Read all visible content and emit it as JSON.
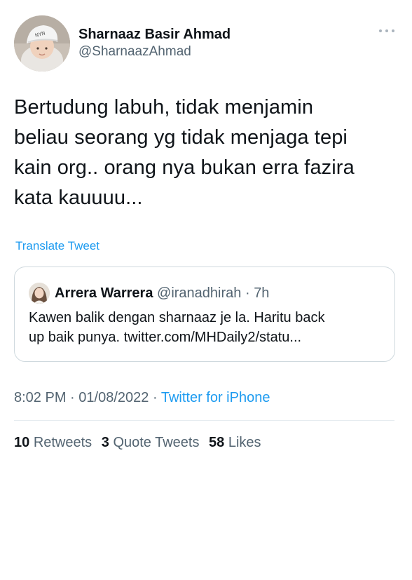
{
  "author": {
    "display_name": "Sharnaaz Basir Ahmad",
    "handle": "@SharnaazAhmad"
  },
  "tweet": {
    "lines": [
      "Bertudung labuh, tidak menjamin",
      "beliau seorang yg tidak menjaga tepi",
      "kain org.. orang nya bukan erra fazira",
      "kata kauuuu..."
    ],
    "translate_label": "Translate Tweet"
  },
  "quote": {
    "display_name": "Arrera Warrera",
    "handle": "@iranadhirah",
    "separator": "·",
    "time": "7h",
    "lines": [
      "Kawen balik dengan sharnaaz je la. Haritu back",
      "up baik punya. twitter.com/MHDaily2/statu..."
    ]
  },
  "meta": {
    "time": "8:02 PM",
    "separator": "·",
    "date": "01/08/2022",
    "source": "Twitter for iPhone"
  },
  "stats": {
    "retweets_count": "10",
    "retweets_label": "Retweets",
    "quotes_count": "3",
    "quotes_label": "Quote Tweets",
    "likes_count": "58",
    "likes_label": "Likes"
  },
  "icons": {
    "more": "more-horizontal-icon"
  },
  "colors": {
    "accent": "#1d9bf0",
    "secondary_text": "#536471",
    "border": "#cfd9de"
  }
}
